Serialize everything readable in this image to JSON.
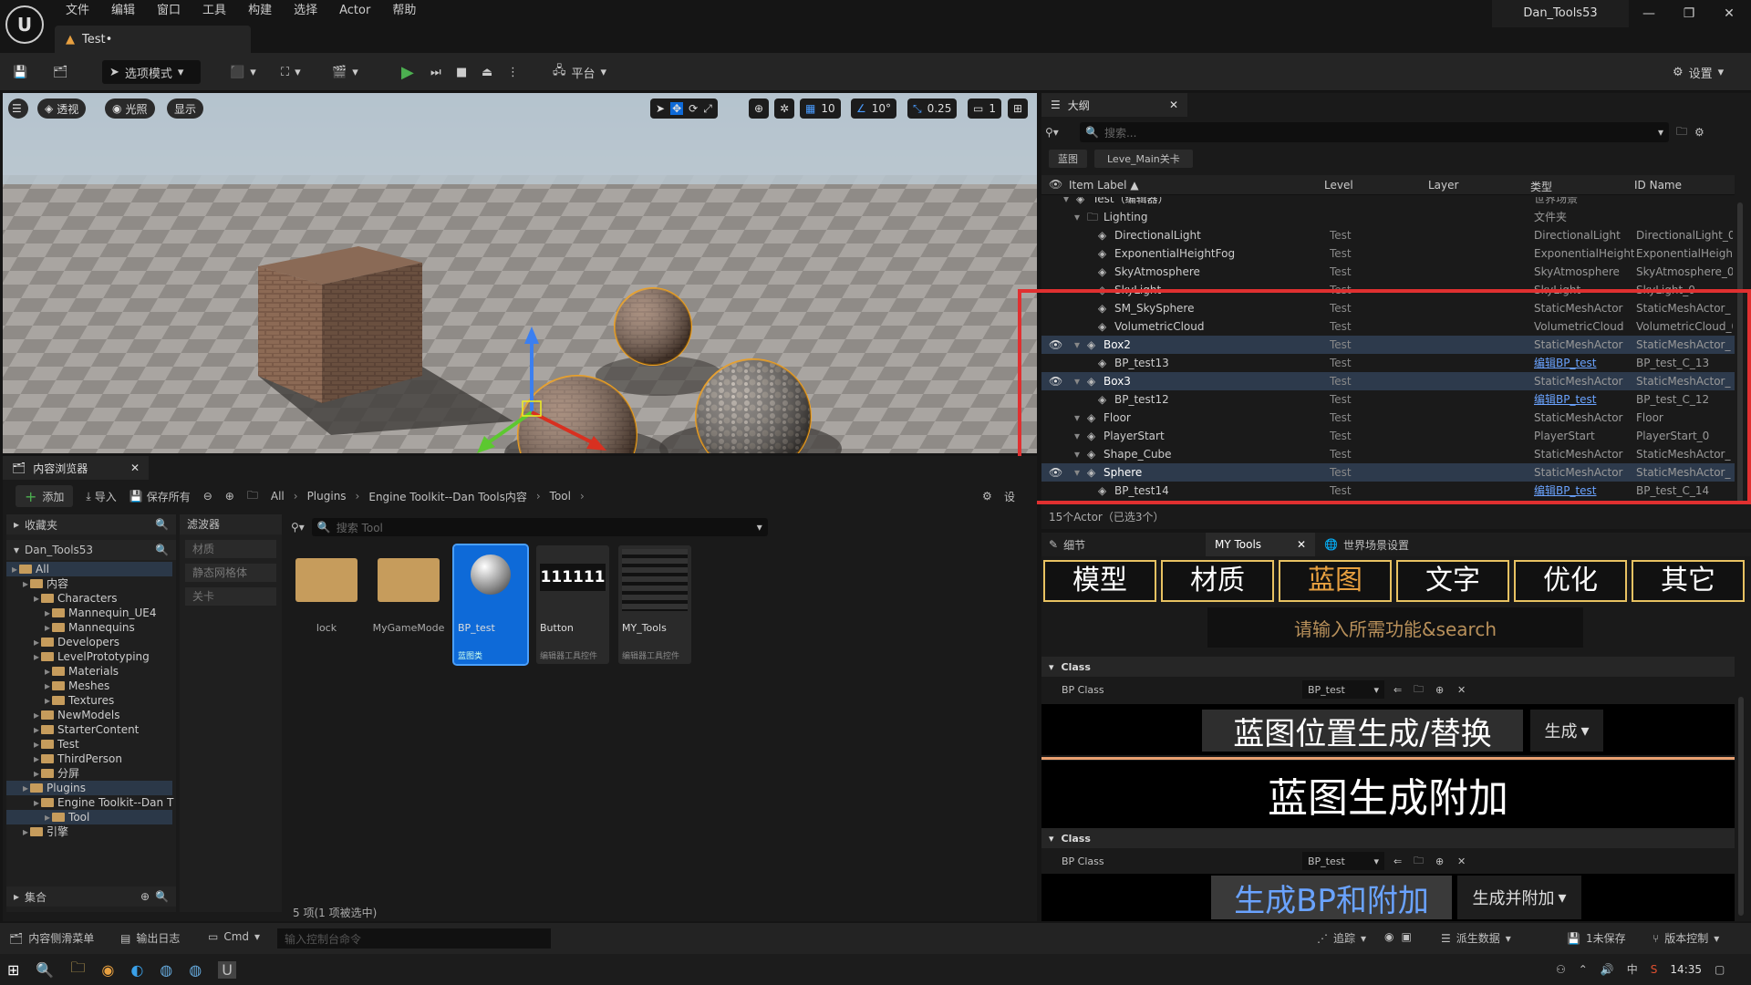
{
  "menu": [
    "文件",
    "编辑",
    "窗口",
    "工具",
    "构建",
    "选择",
    "Actor",
    "帮助"
  ],
  "tab_title": "Test•",
  "project_name": "Dan_Tools53",
  "window_controls": [
    "—",
    "❐",
    "✕"
  ],
  "toolbar": {
    "mode": "选项模式",
    "platform": "平台",
    "settings": "设置"
  },
  "viewport": {
    "perspective": "透视",
    "lighting": "光照",
    "show": "显示",
    "grid": "10",
    "angle": "10°",
    "scale": "0.25",
    "camera": "1"
  },
  "outliner": {
    "title": "大纲",
    "search_placeholder": "搜索...",
    "filter_chips": [
      "蓝图",
      "Leve_Main关卡"
    ],
    "columns": [
      "Item Label ▲",
      "Level",
      "Layer",
      "类型",
      "ID Name"
    ],
    "rows": [
      {
        "indent": 0,
        "label": "Test（编辑器）",
        "level": "",
        "type": "世界场景",
        "id": "",
        "sel": false,
        "vis": false
      },
      {
        "indent": 1,
        "label": "Lighting",
        "level": "",
        "type": "文件夹",
        "id": "",
        "sel": false,
        "vis": false
      },
      {
        "indent": 2,
        "label": "DirectionalLight",
        "level": "Test",
        "type": "DirectionalLight",
        "id": "DirectionalLight_0",
        "sel": false,
        "vis": false
      },
      {
        "indent": 2,
        "label": "ExponentialHeightFog",
        "level": "Test",
        "type": "ExponentialHeightl",
        "id": "ExponentialHeight",
        "sel": false,
        "vis": false
      },
      {
        "indent": 2,
        "label": "SkyAtmosphere",
        "level": "Test",
        "type": "SkyAtmosphere",
        "id": "SkyAtmosphere_0",
        "sel": false,
        "vis": false
      },
      {
        "indent": 2,
        "label": "SkyLight",
        "level": "Test",
        "type": "SkyLight",
        "id": "SkyLight_0",
        "sel": false,
        "vis": false
      },
      {
        "indent": 2,
        "label": "SM_SkySphere",
        "level": "Test",
        "type": "StaticMeshActor",
        "id": "StaticMeshActor_",
        "sel": false,
        "vis": false
      },
      {
        "indent": 2,
        "label": "VolumetricCloud",
        "level": "Test",
        "type": "VolumetricCloud",
        "id": "VolumetricCloud_0",
        "sel": false,
        "vis": false
      },
      {
        "indent": 1,
        "label": "Box2",
        "level": "Test",
        "type": "StaticMeshActor",
        "id": "StaticMeshActor_",
        "sel": true,
        "vis": true
      },
      {
        "indent": 2,
        "label": "BP_test13",
        "level": "Test",
        "type": "编辑BP_test",
        "id": "BP_test_C_13",
        "sel": false,
        "vis": false,
        "link": true
      },
      {
        "indent": 1,
        "label": "Box3",
        "level": "Test",
        "type": "StaticMeshActor",
        "id": "StaticMeshActor_",
        "sel": true,
        "vis": true
      },
      {
        "indent": 2,
        "label": "BP_test12",
        "level": "Test",
        "type": "编辑BP_test",
        "id": "BP_test_C_12",
        "sel": false,
        "vis": false,
        "link": true
      },
      {
        "indent": 1,
        "label": "Floor",
        "level": "Test",
        "type": "StaticMeshActor",
        "id": "Floor",
        "sel": false,
        "vis": false
      },
      {
        "indent": 1,
        "label": "PlayerStart",
        "level": "Test",
        "type": "PlayerStart",
        "id": "PlayerStart_0",
        "sel": false,
        "vis": false
      },
      {
        "indent": 1,
        "label": "Shape_Cube",
        "level": "Test",
        "type": "StaticMeshActor",
        "id": "StaticMeshActor_",
        "sel": false,
        "vis": false
      },
      {
        "indent": 1,
        "label": "Sphere",
        "level": "Test",
        "type": "StaticMeshActor",
        "id": "StaticMeshActor_",
        "sel": true,
        "vis": true
      },
      {
        "indent": 2,
        "label": "BP_test14",
        "level": "Test",
        "type": "编辑BP_test",
        "id": "BP_test_C_14",
        "sel": false,
        "vis": false,
        "link": true
      }
    ],
    "footer": "15个Actor（已选3个）"
  },
  "content_browser": {
    "title": "内容浏览器",
    "add": "添加",
    "import": "导入",
    "save_all": "保存所有",
    "breadcrumb": [
      "All",
      "Plugins",
      "Engine Toolkit--Dan Tools内容",
      "Tool"
    ],
    "settings": "设",
    "favorites": "收藏夹",
    "project": "Dan_Tools53",
    "filters_title": "滤波器",
    "filters": [
      "材质",
      "静态网格体",
      "关卡"
    ],
    "search_placeholder": "搜索 Tool",
    "tree": [
      {
        "d": 0,
        "t": "All",
        "sel": true
      },
      {
        "d": 1,
        "t": "内容"
      },
      {
        "d": 2,
        "t": "Characters"
      },
      {
        "d": 3,
        "t": "Mannequin_UE4"
      },
      {
        "d": 3,
        "t": "Mannequins"
      },
      {
        "d": 2,
        "t": "Developers"
      },
      {
        "d": 2,
        "t": "LevelPrototyping"
      },
      {
        "d": 3,
        "t": "Materials"
      },
      {
        "d": 3,
        "t": "Meshes"
      },
      {
        "d": 3,
        "t": "Textures"
      },
      {
        "d": 2,
        "t": "NewModels"
      },
      {
        "d": 2,
        "t": "StarterContent"
      },
      {
        "d": 2,
        "t": "Test"
      },
      {
        "d": 2,
        "t": "ThirdPerson"
      },
      {
        "d": 2,
        "t": "分屏"
      },
      {
        "d": 1,
        "t": "Plugins",
        "sel": true
      },
      {
        "d": 2,
        "t": "Engine Toolkit--Dan T"
      },
      {
        "d": 3,
        "t": "Tool",
        "sel": true
      },
      {
        "d": 1,
        "t": "引擎"
      }
    ],
    "collections": "集合",
    "assets": [
      {
        "name": "lock",
        "kind": "folder"
      },
      {
        "name": "MyGameMode",
        "kind": "folder"
      },
      {
        "name": "BP_test",
        "kind": "bp",
        "sub": "蓝图类"
      },
      {
        "name": "Button",
        "kind": "widget",
        "sub": "编辑器工具控件",
        "thumb": "111111"
      },
      {
        "name": "MY_Tools",
        "kind": "widget2",
        "sub": "编辑器工具控件"
      }
    ],
    "status": "5 项(1 项被选中)"
  },
  "details": {
    "tab_details": "细节",
    "tab_mytools": "MY Tools",
    "tab_world": "世界场景设置",
    "categories": [
      "模型",
      "材质",
      "蓝图",
      "文字",
      "优化",
      "其它"
    ],
    "active_category": "蓝图",
    "search_hint": "请输入所需功能&search",
    "section1": {
      "header": "Class",
      "label": "BP Class",
      "value": "BP_test"
    },
    "btn_spawn_replace": "蓝图位置生成/替换",
    "btn_spawn_mode": "生成",
    "btn_spawn_attach": "蓝图生成附加",
    "section2": {
      "header": "Class",
      "label": "BP Class",
      "value": "BP_test"
    },
    "btn_bp_attach": "生成BP和附加",
    "btn_bp_attach_mode": "生成并附加"
  },
  "statusbar": {
    "drawer": "内容侧滑菜单",
    "log": "输出日志",
    "cmd": "Cmd",
    "console_placeholder": "输入控制台命令",
    "trace": "追踪",
    "derived": "派生数据",
    "unsaved": "1未保存",
    "vcs": "版本控制"
  },
  "taskbar": {
    "time": "14:35"
  },
  "colors": {
    "accent": "#e8c262",
    "selection": "#2d3a4c",
    "highlight_box": "#e03030",
    "link": "#6aa3ff",
    "blue_text": "#6aa3ff"
  }
}
